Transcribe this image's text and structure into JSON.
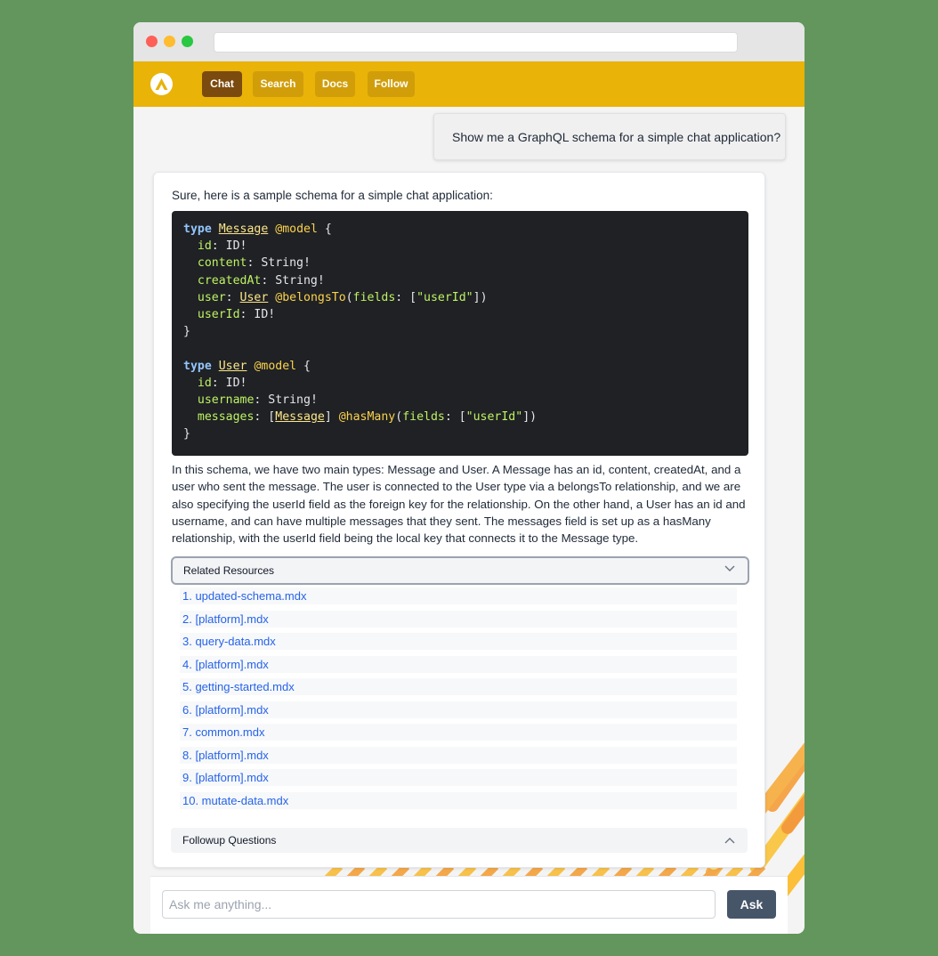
{
  "nav": {
    "items": [
      {
        "label": "Chat"
      },
      {
        "label": "Search"
      },
      {
        "label": "Docs"
      },
      {
        "label": "Follow"
      }
    ],
    "active": "Chat"
  },
  "conversation": {
    "user_question": "Show me a GraphQL schema for a simple chat application?",
    "answer_intro": "Sure, here is a sample schema for a simple chat application:",
    "answer_explanation": "In this schema, we have two main types: Message and User. A Message has an id, content, createdAt, and a user who sent the message. The user is connected to the User type via a belongsTo relationship, and we are also specifying the userId field as the foreign key for the relationship. On the other hand, a User has an id and username, and can have multiple messages that they sent. The messages field is set up as a hasMany relationship, with the userId field being the local key that connects it to the Message type."
  },
  "related": {
    "title": "Related Resources",
    "items": [
      "1. updated-schema.mdx",
      "2. [platform].mdx",
      "3. query-data.mdx",
      "4. [platform].mdx",
      "5. getting-started.mdx",
      "6. [platform].mdx",
      "7. common.mdx",
      "8. [platform].mdx",
      "9. [platform].mdx",
      "10. mutate-data.mdx"
    ]
  },
  "followup": {
    "title": "Followup Questions"
  },
  "input": {
    "placeholder": "Ask me anything...",
    "button_label": "Ask"
  },
  "colors": {
    "page_background": "#62965c",
    "navbar": "#e9b308",
    "active_nav": "#7b4a0e",
    "link": "#2563eb",
    "code_background": "#1f2124"
  }
}
